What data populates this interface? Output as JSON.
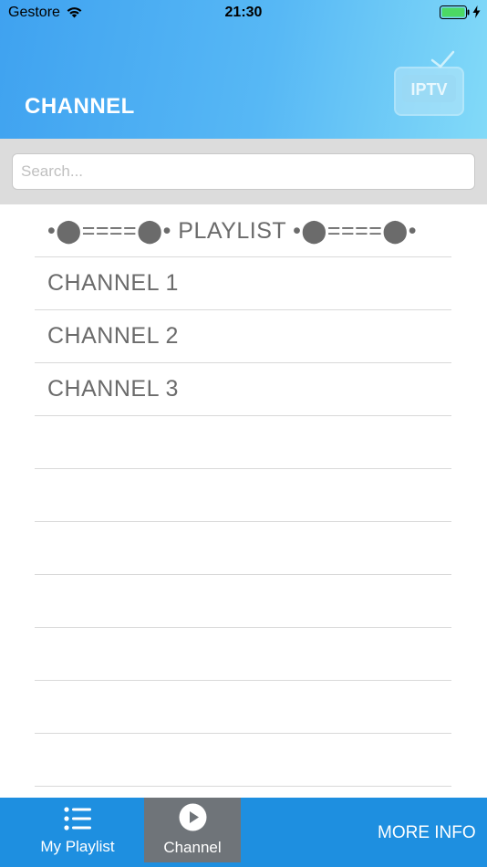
{
  "status_bar": {
    "carrier": "Gestore",
    "time": "21:30"
  },
  "header": {
    "title": "CHANNEL",
    "logo_text": "IPTV"
  },
  "search": {
    "placeholder": "Search...",
    "value": ""
  },
  "list": {
    "section_header": "•⬤====⬤• PLAYLIST •⬤====⬤•",
    "items": [
      {
        "label": "CHANNEL 1"
      },
      {
        "label": "CHANNEL 2"
      },
      {
        "label": "CHANNEL 3"
      }
    ]
  },
  "tab_bar": {
    "tabs": [
      {
        "label": "My Playlist",
        "icon": "list-icon",
        "selected": false
      },
      {
        "label": "Channel",
        "icon": "play-circle-icon",
        "selected": true
      }
    ],
    "more_info_label": "MORE INFO"
  },
  "colors": {
    "header_gradient_start": "#3fa2f0",
    "header_gradient_end": "#82daf8",
    "tab_bar": "#1e8fe0",
    "tab_selected": "#6f7479",
    "list_text": "#6b6b6b"
  }
}
